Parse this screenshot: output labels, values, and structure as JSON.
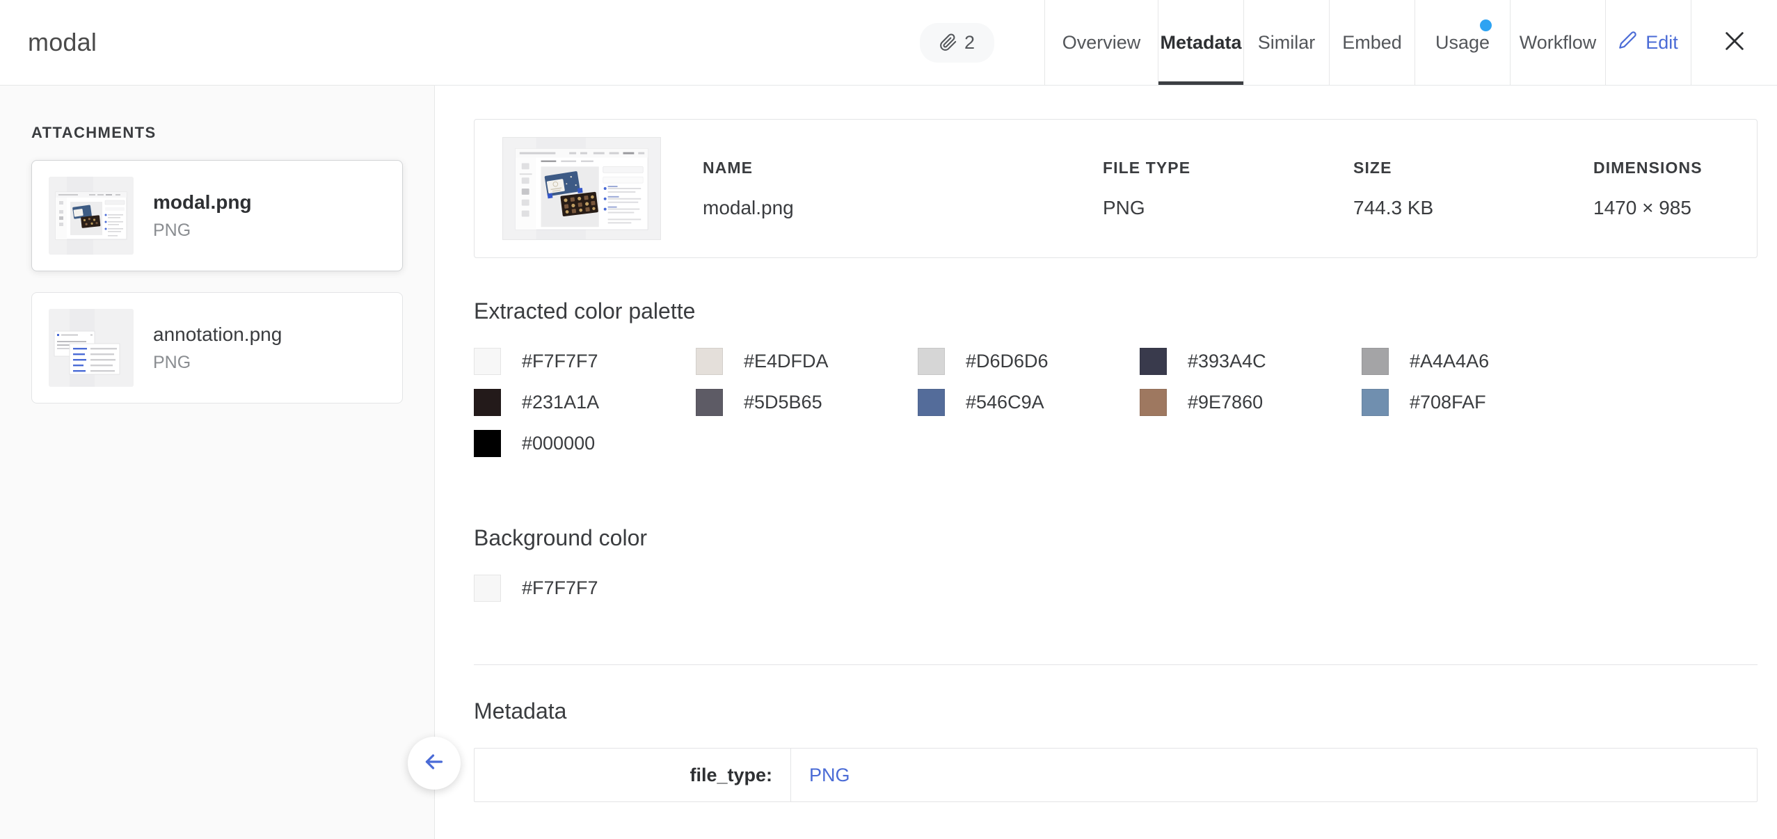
{
  "header": {
    "title": "modal",
    "attachment_badge": {
      "icon": "paperclip-icon",
      "count": "2"
    },
    "tabs": [
      {
        "label": "Overview",
        "active": false,
        "dot": false
      },
      {
        "label": "Metadata",
        "active": true,
        "dot": false
      },
      {
        "label": "Similar",
        "active": false,
        "dot": false
      },
      {
        "label": "Embed",
        "active": false,
        "dot": false
      },
      {
        "label": "Usage",
        "active": false,
        "dot": true
      },
      {
        "label": "Workflow",
        "active": false,
        "dot": false
      }
    ],
    "edit_label": "Edit",
    "edit_icon": "pencil-icon",
    "close_icon": "close-icon",
    "accent_color": "#4a6bd6",
    "dot_color": "#2ea3f2"
  },
  "sidebar": {
    "heading": "ATTACHMENTS",
    "items": [
      {
        "name": "modal.png",
        "type": "PNG",
        "selected": true,
        "thumb": "modal-screenshot-thumb"
      },
      {
        "name": "annotation.png",
        "type": "PNG",
        "selected": false,
        "thumb": "annotation-screenshot-thumb"
      }
    ],
    "back_button_icon": "arrow-left-icon"
  },
  "main": {
    "file_card": {
      "thumb": "modal-screenshot-thumb",
      "fields": [
        {
          "label": "NAME",
          "value": "modal.png"
        },
        {
          "label": "FILE TYPE",
          "value": "PNG"
        },
        {
          "label": "SIZE",
          "value": "744.3 KB"
        },
        {
          "label": "DIMENSIONS",
          "value": "1470 × 985"
        }
      ]
    },
    "palette": {
      "title": "Extracted color palette",
      "colors": [
        "#F7F7F7",
        "#E4DFDA",
        "#D6D6D6",
        "#393A4C",
        "#A4A4A6",
        "#231A1A",
        "#5D5B65",
        "#546C9A",
        "#9E7860",
        "#708FAF",
        "#000000"
      ]
    },
    "background": {
      "title": "Background color",
      "colors": [
        "#F7F7F7"
      ]
    },
    "metadata": {
      "title": "Metadata",
      "rows": [
        {
          "key": "file_type:",
          "value": "PNG"
        }
      ]
    }
  }
}
